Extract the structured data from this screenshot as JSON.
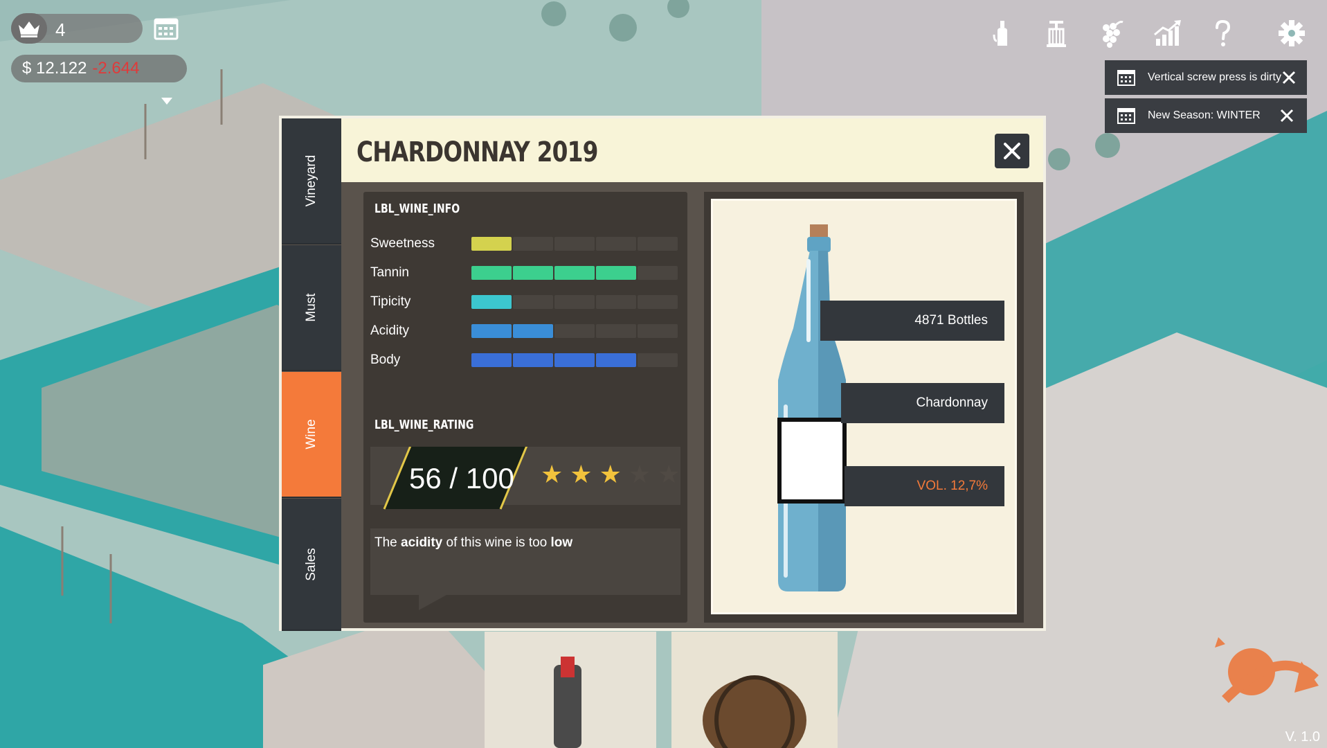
{
  "hud": {
    "level": "4",
    "money": "$ 12.122",
    "money_delta": "-2.644"
  },
  "top_icons": [
    "wine-bottle-icon",
    "press-icon",
    "grapes-icon",
    "statistics-icon",
    "help-icon",
    "settings-icon"
  ],
  "notifications": [
    {
      "text": "Vertical screw press is dirty"
    },
    {
      "text": "New Season: WINTER"
    }
  ],
  "dialog": {
    "title": "CHARDONNAY 2019",
    "tabs": [
      {
        "label": "Vineyard",
        "active": false
      },
      {
        "label": "Must",
        "active": false
      },
      {
        "label": "Wine",
        "active": true
      },
      {
        "label": "Sales",
        "active": false
      }
    ],
    "wine_info_label": "LBL_WINE_INFO",
    "attributes": [
      {
        "name": "Sweetness",
        "level": 1,
        "max": 5,
        "color": "#d4d24e"
      },
      {
        "name": "Tannin",
        "level": 4,
        "max": 5,
        "color": "#3ccf8e"
      },
      {
        "name": "Tipicity",
        "level": 1,
        "max": 5,
        "color": "#3cc7cf"
      },
      {
        "name": "Acidity",
        "level": 2,
        "max": 5,
        "color": "#3a8ed8"
      },
      {
        "name": "Body",
        "level": 4,
        "max": 5,
        "color": "#3a6fd8"
      }
    ],
    "wine_rating_label": "LBL_WINE_RATING",
    "score": "56 / 100",
    "stars": 3,
    "stars_max": 5,
    "comment": {
      "pre": "The ",
      "bold1": "acidity",
      "mid": " of this wine is too ",
      "bold2": "low"
    },
    "bottle_info": {
      "bottles": "4871 Bottles",
      "variety": "Chardonnay",
      "volume": "VOL. 12,7%"
    }
  },
  "version": "V. 1.0",
  "colors": {
    "accent_tab": "#f47a3a",
    "panel_dark": "#3e3934",
    "header_bg": "#f8f4d8",
    "negative": "#e03a3a"
  }
}
